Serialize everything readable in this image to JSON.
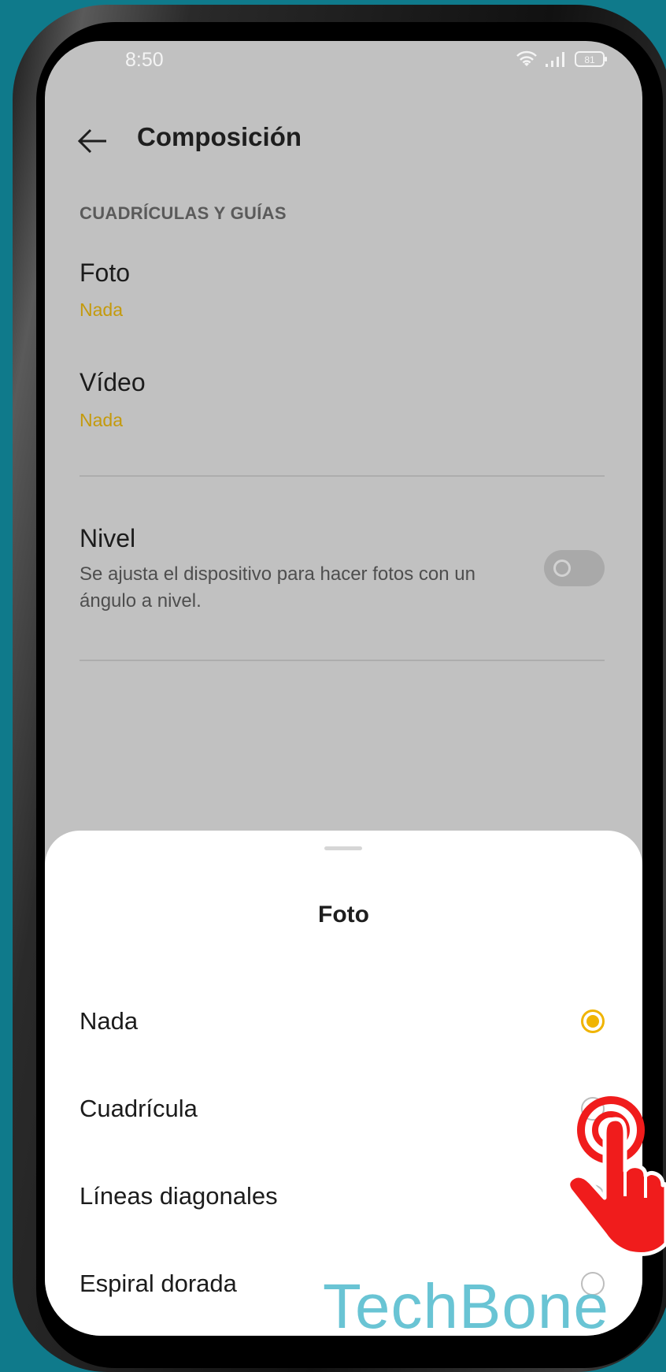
{
  "status_bar": {
    "time": "8:50",
    "battery": "81",
    "icons": [
      "wifi-icon",
      "signal-icon",
      "battery-icon"
    ]
  },
  "header": {
    "title": "Composición",
    "back_icon": "arrow-left-icon"
  },
  "section": {
    "header": "CUADRÍCULAS Y GUÍAS"
  },
  "settings": {
    "foto": {
      "title": "Foto",
      "value": "Nada"
    },
    "video": {
      "title": "Vídeo",
      "value": "Nada"
    },
    "level": {
      "title": "Nivel",
      "description": "Se ajusta el dispositivo para hacer fotos con un ángulo a nivel.",
      "enabled": false
    }
  },
  "sheet": {
    "title": "Foto",
    "options": [
      {
        "label": "Nada",
        "selected": true
      },
      {
        "label": "Cuadrícula",
        "selected": false
      },
      {
        "label": "Líneas diagonales",
        "selected": false
      },
      {
        "label": "Espiral dorada",
        "selected": false
      }
    ]
  },
  "watermark": "TechBone",
  "colors": {
    "accent": "#f0b400",
    "value_text": "#c49a0c",
    "background": "#0f7a8b",
    "watermark": "#69c4d4",
    "hand": "#f01c1c"
  }
}
